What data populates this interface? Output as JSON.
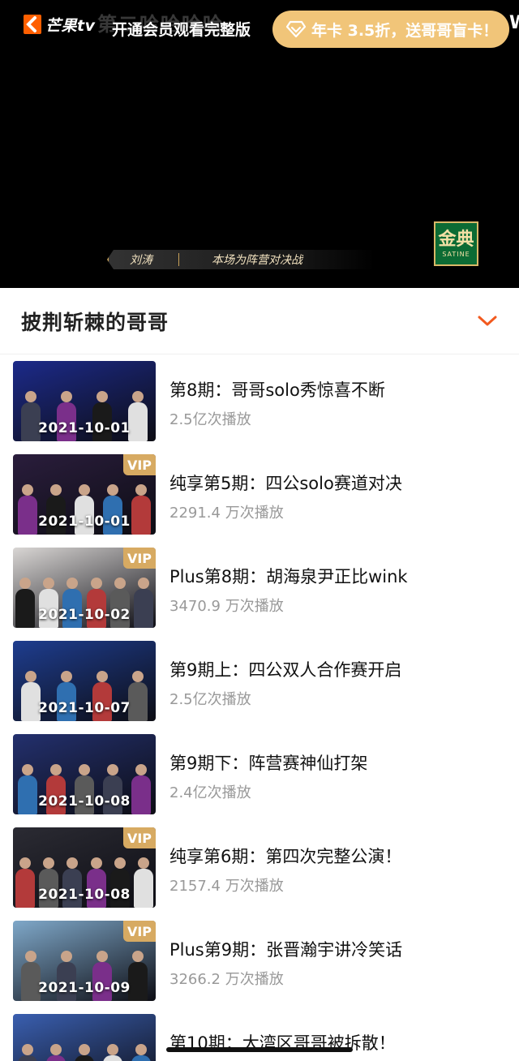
{
  "player": {
    "logo_text": "芒果tv",
    "watermark_title": "第二哈哈哈哈",
    "vip_prompt": "开通会员观看完整版",
    "promo_button": "年卡 3.5折，送哥哥盲卡！",
    "edge_letter": "W",
    "lower_third": {
      "name": "刘涛",
      "caption": "本场为阵营对决战"
    },
    "sponsor": {
      "main": "金典",
      "sub": "SATINE"
    }
  },
  "series": {
    "title": "披荆斩棘的哥哥",
    "accent_color": "#f25a1f"
  },
  "episodes": [
    {
      "title": "第8期：哥哥solo秀惊喜不断",
      "plays": "2.5亿次播放",
      "date": "2021-10-01",
      "vip": "",
      "bg": "#1c2a8a"
    },
    {
      "title": "纯享第5期：四公solo赛道对决",
      "plays": "2291.4 万次播放",
      "date": "2021-10-01",
      "vip": "VIP",
      "bg": "#2a1d3c"
    },
    {
      "title": "Plus第8期：胡海泉尹正比wink",
      "plays": "3470.9 万次播放",
      "date": "2021-10-02",
      "vip": "VIP",
      "bg": "#d9d6d4"
    },
    {
      "title": "第9期上：四公双人合作赛开启",
      "plays": "2.5亿次播放",
      "date": "2021-10-07",
      "vip": "",
      "bg": "#1e3d8f"
    },
    {
      "title": "第9期下：阵营赛神仙打架",
      "plays": "2.4亿次播放",
      "date": "2021-10-08",
      "vip": "",
      "bg": "#23306e"
    },
    {
      "title": "纯享第6期：第四次完整公演！",
      "plays": "2157.4 万次播放",
      "date": "2021-10-08",
      "vip": "VIP",
      "bg": "#2b2b33"
    },
    {
      "title": "Plus第9期：张晋瀚宇讲冷笑话",
      "plays": "3266.2 万次播放",
      "date": "2021-10-09",
      "vip": "VIP",
      "bg": "#7fa8c9"
    },
    {
      "title": "第10期：大湾区哥哥被拆散！",
      "plays": "",
      "date": "",
      "vip": "",
      "bg": "#3a5fb0"
    }
  ]
}
